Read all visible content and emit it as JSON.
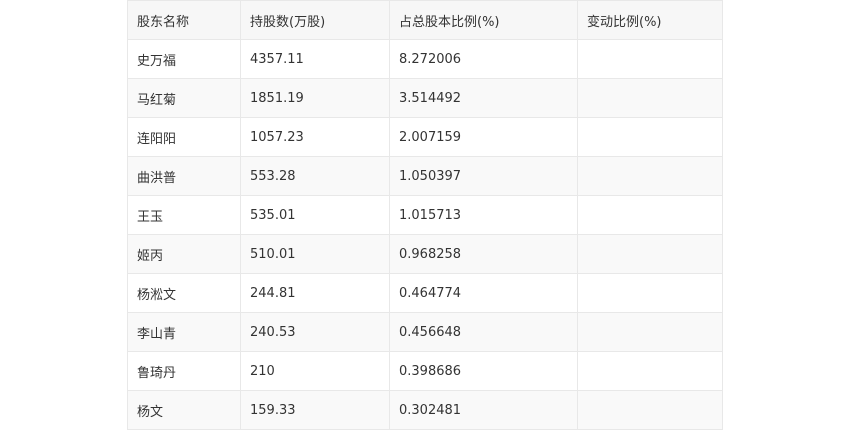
{
  "table": {
    "headers": [
      "股东名称",
      "持股数(万股)",
      "占总股本比例(%)",
      "变动比例(%)"
    ],
    "rows": [
      [
        "史万福",
        "4357.11",
        "8.272006",
        ""
      ],
      [
        "马红菊",
        "1851.19",
        "3.514492",
        ""
      ],
      [
        "连阳阳",
        "1057.23",
        "2.007159",
        ""
      ],
      [
        "曲洪普",
        "553.28",
        "1.050397",
        ""
      ],
      [
        "王玉",
        "535.01",
        "1.015713",
        ""
      ],
      [
        "姬丙",
        "510.01",
        "0.968258",
        ""
      ],
      [
        "杨淞文",
        "244.81",
        "0.464774",
        ""
      ],
      [
        "李山青",
        "240.53",
        "0.456648",
        ""
      ],
      [
        "鲁琦丹",
        "210",
        "0.398686",
        ""
      ],
      [
        "杨文",
        "159.33",
        "0.302481",
        ""
      ]
    ]
  }
}
